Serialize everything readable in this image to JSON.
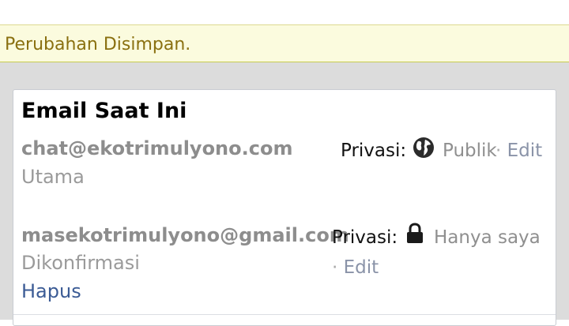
{
  "notice": {
    "message": "Perubahan Disimpan."
  },
  "emails_section": {
    "title": "Email Saat Ini",
    "privacy_label": "Privasi:",
    "separator": "·",
    "edit_label": "Edit",
    "entries": [
      {
        "address": "chat@ekotrimulyono.com",
        "status": "Utama",
        "privacy": "Publik",
        "privacy_icon": "globe-icon"
      },
      {
        "address": "masekotrimulyono@gmail.com",
        "status": "Dikonfirmasi",
        "remove_label": "Hapus",
        "privacy": "Hanya saya",
        "privacy_icon": "lock-icon"
      }
    ]
  },
  "colors": {
    "notice_background": "#fbfbde",
    "notice_text": "#8a7010",
    "link": "#3b5b95",
    "muted_text": "#8d8d8d"
  }
}
